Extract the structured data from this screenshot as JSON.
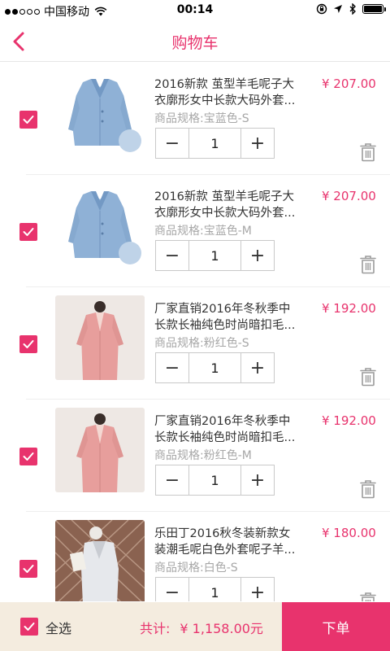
{
  "status_bar": {
    "carrier": "中国移动",
    "time": "00:14"
  },
  "nav": {
    "title": "购物车",
    "back_icon": "chevron-left-icon"
  },
  "colors": {
    "accent": "#e8336d",
    "footer_bg": "#f4ecdf"
  },
  "items": [
    {
      "title_line1": "2016新款 茧型羊毛呢子大",
      "title_line2": "衣廓形女中长款大码外套...",
      "spec": "商品规格:宝蓝色-S",
      "price": "¥ 207.00",
      "quantity": "1",
      "minus": "−",
      "plus": "+",
      "checked": true,
      "image": "blue-wool-coat"
    },
    {
      "title_line1": "2016新款 茧型羊毛呢子大",
      "title_line2": "衣廓形女中长款大码外套...",
      "spec": "商品规格:宝蓝色-M",
      "price": "¥ 207.00",
      "quantity": "1",
      "minus": "−",
      "plus": "+",
      "checked": true,
      "image": "blue-wool-coat"
    },
    {
      "title_line1": "厂家直销2016年冬秋季中",
      "title_line2": "长款长袖纯色时尚暗扣毛...",
      "spec": "商品规格:粉红色-S",
      "price": "¥ 192.00",
      "quantity": "1",
      "minus": "−",
      "plus": "+",
      "checked": true,
      "image": "pink-coat"
    },
    {
      "title_line1": "厂家直销2016年冬秋季中",
      "title_line2": "长款长袖纯色时尚暗扣毛...",
      "spec": "商品规格:粉红色-M",
      "price": "¥ 192.00",
      "quantity": "1",
      "minus": "−",
      "plus": "+",
      "checked": true,
      "image": "pink-coat"
    },
    {
      "title_line1": "乐田丁2016秋冬装新款女",
      "title_line2": "装潮毛呢白色外套呢子羊...",
      "spec": "商品规格:白色-S",
      "price": "¥ 180.00",
      "quantity": "1",
      "minus": "−",
      "plus": "+",
      "checked": true,
      "image": "white-coat"
    }
  ],
  "footer": {
    "select_all_label": "全选",
    "total_label": "共计:",
    "total_value": "¥ 1,158.00元",
    "checkout_label": "下单",
    "select_all_checked": true
  }
}
